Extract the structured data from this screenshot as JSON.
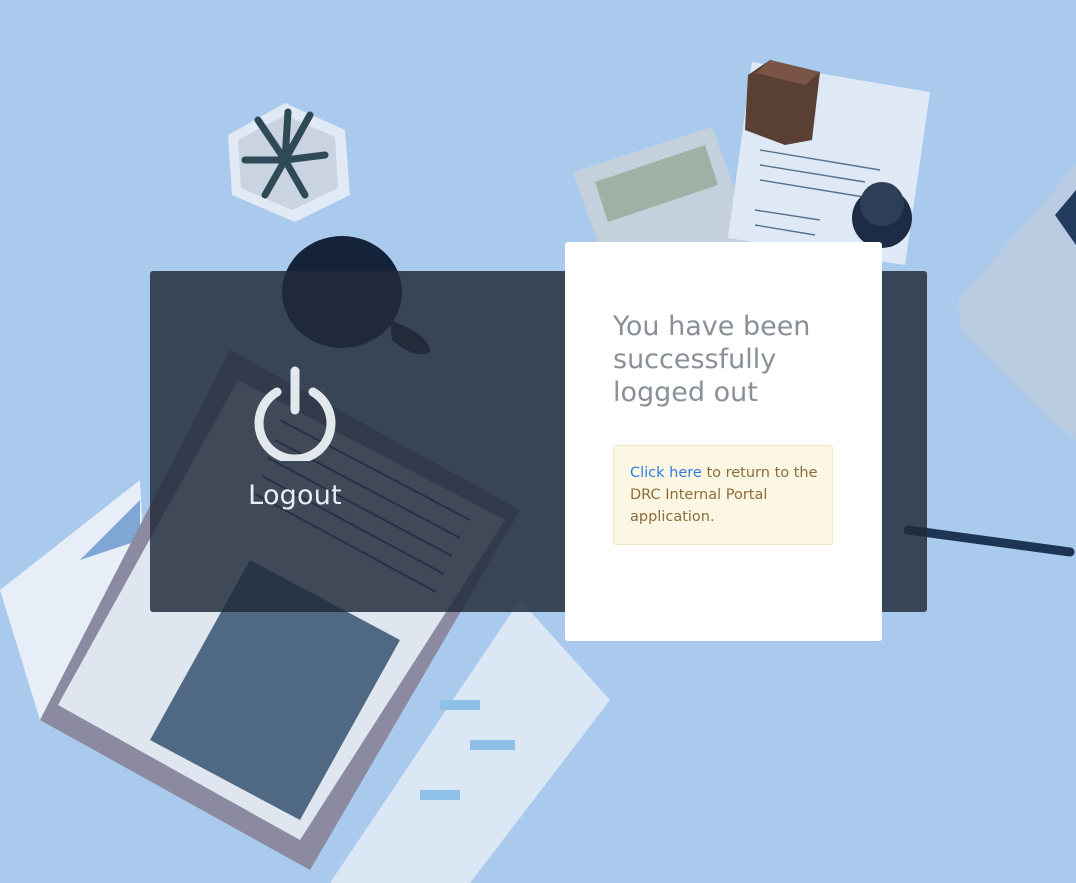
{
  "logout_panel": {
    "label": "Logout",
    "icon": "power-icon"
  },
  "message_card": {
    "title": "You have been successfully logged out",
    "alert": {
      "link_text": "Click here",
      "text_after_link": " to return to the DRC Internal Portal application."
    }
  },
  "colors": {
    "background_tint": "#a9caed",
    "link": "#2f7de1",
    "alert_text": "#8a6d3b",
    "alert_background": "#fcf7e3",
    "title_text": "#8a9097"
  }
}
